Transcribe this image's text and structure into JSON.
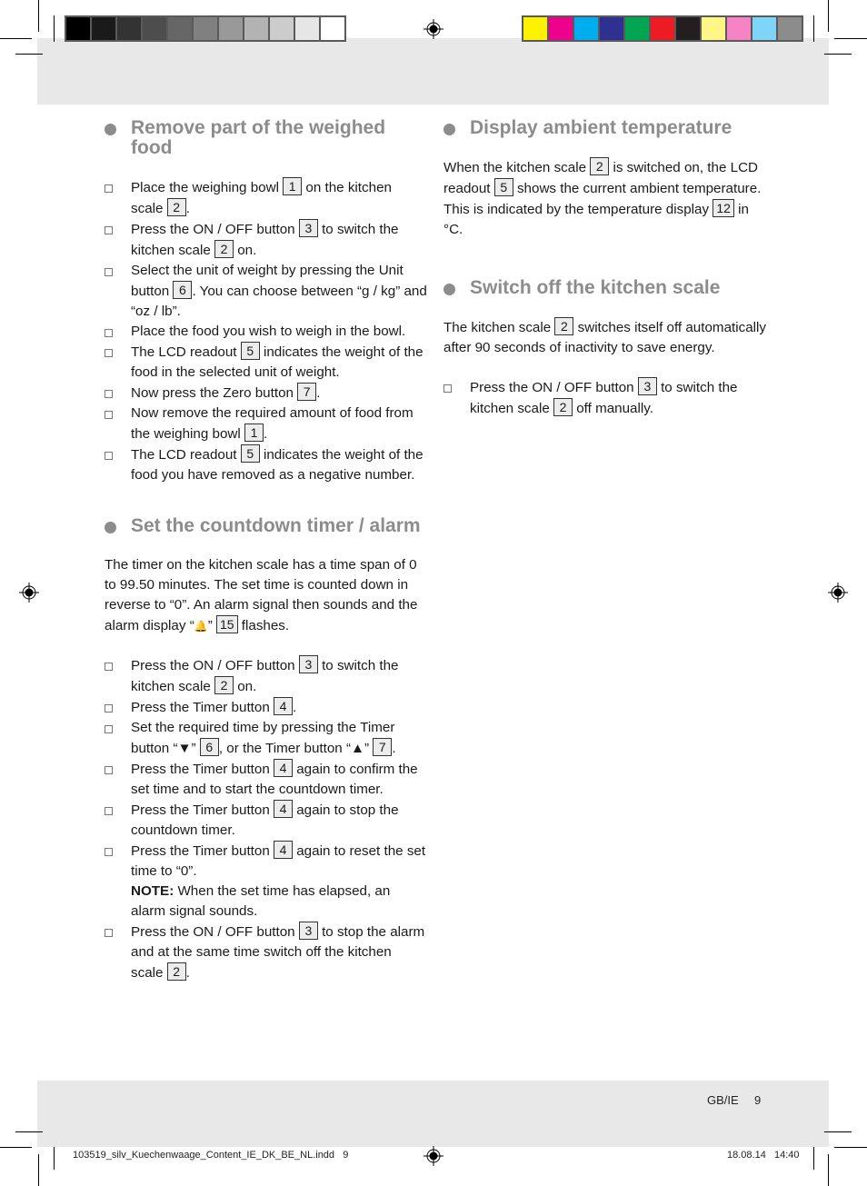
{
  "print_marks": {
    "gray_swatches": [
      "#000000",
      "#1a1a1a",
      "#333333",
      "#4d4d4d",
      "#666666",
      "#808080",
      "#999999",
      "#b3b3b3",
      "#cccccc",
      "#e6e6e6",
      "#ffffff"
    ],
    "cmyk_swatches": [
      "#fff200",
      "#ec008c",
      "#00aeef",
      "#2e3192",
      "#00a651",
      "#ed1c24",
      "#231f20",
      "#fff685",
      "#f684c4",
      "#7fd5f7",
      "#8c8c8c"
    ]
  },
  "left_column": {
    "section1": {
      "title": "Remove part of the weighed food",
      "steps": [
        {
          "parts": [
            "Place the weighing bowl ",
            "1",
            " on the kitchen scale ",
            "2",
            "."
          ]
        },
        {
          "parts": [
            "Press the ON / OFF button ",
            "3",
            " to switch the kitchen scale ",
            "2",
            " on."
          ]
        },
        {
          "parts": [
            "Select the unit of weight by pressing the Unit button ",
            "6",
            ". You can choose between “g / kg” and “oz / lb”."
          ]
        },
        {
          "parts": [
            "Place the food you wish to weigh in the bowl."
          ]
        },
        {
          "parts": [
            "The LCD readout ",
            "5",
            " indicates the weight of the food in the selected unit of weight."
          ]
        },
        {
          "parts": [
            "Now press the Zero button ",
            "7",
            "."
          ]
        },
        {
          "parts": [
            "Now remove the required amount of food from the weighing bowl ",
            "1",
            "."
          ]
        },
        {
          "parts": [
            "The LCD readout ",
            "5",
            " indicates the weight of the food you have removed as a negative number."
          ]
        }
      ]
    },
    "section2": {
      "title": "Set the countdown timer / alarm",
      "intro_a": "The timer on the kitchen scale has a time span of 0 to 99.50 minutes. The set time is counted down in reverse to “0”. An alarm signal then sounds and the alarm display “",
      "alarm_glyph": "🔔",
      "intro_b": "” ",
      "intro_ref": "15",
      "intro_c": " flashes.",
      "steps": [
        {
          "parts": [
            "Press the ON / OFF button ",
            "3",
            " to switch the kitchen scale ",
            "2",
            " on."
          ]
        },
        {
          "parts": [
            "Press the Timer button ",
            "4",
            "."
          ]
        },
        {
          "parts": [
            "Set the required time by pressing the Timer button “▼” ",
            "6",
            ", or the Timer button “▲” ",
            "7",
            "."
          ]
        },
        {
          "parts": [
            "Press the Timer button ",
            "4",
            " again to confirm the set time and to start the countdown timer."
          ]
        },
        {
          "parts": [
            "Press the Timer button ",
            "4",
            " again to stop the countdown timer."
          ]
        },
        {
          "parts": [
            "Press the Timer button ",
            "4",
            " again to reset the set time to “0”."
          ],
          "note_label": "NOTE:",
          "note_text": " When the set time has elapsed, an alarm signal sounds."
        },
        {
          "parts": [
            "Press the ON / OFF button ",
            "3",
            " to stop the alarm and at the same time switch off the kitchen scale ",
            "2",
            "."
          ]
        }
      ]
    }
  },
  "right_column": {
    "section3": {
      "title": "Display ambient temperature",
      "body": [
        "When the kitchen scale ",
        "2",
        " is switched on, the LCD readout ",
        "5",
        " shows the current ambient temperature. This is indicated by the temperature display ",
        "12",
        " in °C."
      ]
    },
    "section4": {
      "title": "Switch off the kitchen scale",
      "body": [
        "The kitchen scale ",
        "2",
        " switches itself off automatically after 90 seconds of inactivity to save energy."
      ],
      "steps": [
        {
          "parts": [
            "Press the ON / OFF button ",
            "3",
            " to switch the kitchen scale ",
            "2",
            " off manually."
          ]
        }
      ]
    }
  },
  "footer": {
    "language": "GB/IE",
    "page_number": "9",
    "slug_file": "103519_silv_Kuechenwaage_Content_IE_DK_BE_NL.indd   9",
    "slug_datetime": "18.08.14   14:40"
  }
}
